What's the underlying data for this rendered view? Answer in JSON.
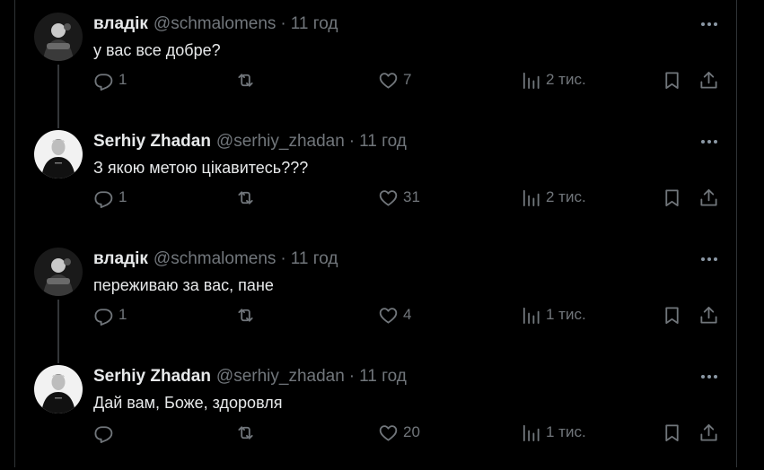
{
  "tweets": [
    {
      "name": "владік",
      "handle": "@schmalomens",
      "time": "11 год",
      "text": "у вас все добре?",
      "reply_count": "1",
      "like_count": "7",
      "views": "2 тис.",
      "avatar": "dark-photo",
      "thread_continues": true
    },
    {
      "name": "Serhiy Zhadan",
      "handle": "@serhiy_zhadan",
      "time": "11 год",
      "text": "З якою метою цікавитесь???",
      "reply_count": "1",
      "like_count": "31",
      "views": "2 тис.",
      "avatar": "light-photo",
      "thread_continues": false
    },
    {
      "name": "владік",
      "handle": "@schmalomens",
      "time": "11 год",
      "text": "переживаю за вас, пане",
      "reply_count": "1",
      "like_count": "4",
      "views": "1 тис.",
      "avatar": "dark-photo",
      "thread_continues": true
    },
    {
      "name": "Serhiy Zhadan",
      "handle": "@serhiy_zhadan",
      "time": "11 год",
      "text": "Дай вам, Боже, здоровля",
      "reply_count": "",
      "like_count": "20",
      "views": "1 тис.",
      "avatar": "light-photo",
      "thread_continues": false
    }
  ],
  "separator": "·",
  "icons": {
    "reply": "reply-icon",
    "retweet": "retweet-icon",
    "like": "heart-icon",
    "views": "views-icon",
    "bookmark": "bookmark-icon",
    "share": "share-icon",
    "more": "more-icon"
  },
  "colors": {
    "background": "#000000",
    "text": "#e7e9ea",
    "muted": "#71767b",
    "divider": "#2f3336"
  }
}
